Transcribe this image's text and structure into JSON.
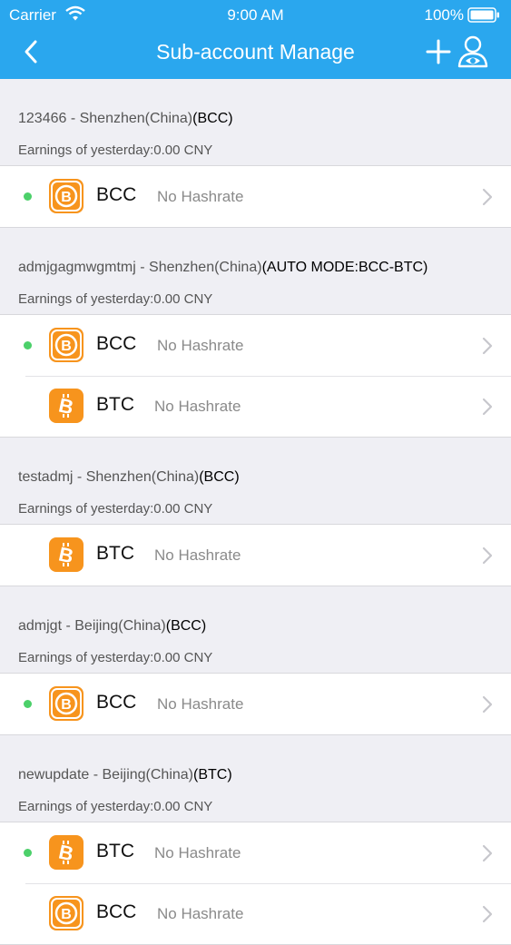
{
  "status_bar": {
    "carrier": "Carrier",
    "time": "9:00 AM",
    "battery": "100%"
  },
  "nav": {
    "title": "Sub-account Manage"
  },
  "groups": [
    {
      "name": "123466 - Shenzhen(China)",
      "mode": "(BCC)",
      "earnings": "Earnings of yesterday:0.00 CNY",
      "rows": [
        {
          "coin": "BCC",
          "hashrate": "No Hashrate",
          "active": true
        }
      ]
    },
    {
      "name": "admjgagmwgmtmj - Shenzhen(China)",
      "mode": "(AUTO MODE:BCC-BTC)",
      "earnings": "Earnings of yesterday:0.00 CNY",
      "rows": [
        {
          "coin": "BCC",
          "hashrate": "No Hashrate",
          "active": true
        },
        {
          "coin": "BTC",
          "hashrate": "No Hashrate",
          "active": false
        }
      ]
    },
    {
      "name": "testadmj - Shenzhen(China)",
      "mode": "(BCC)",
      "earnings": "Earnings of yesterday:0.00 CNY",
      "rows": [
        {
          "coin": "BTC",
          "hashrate": "No Hashrate",
          "active": false
        }
      ]
    },
    {
      "name": "admjgt - Beijing(China)",
      "mode": "(BCC)",
      "earnings": "Earnings of yesterday:0.00 CNY",
      "rows": [
        {
          "coin": "BCC",
          "hashrate": "No Hashrate",
          "active": true
        }
      ]
    },
    {
      "name": "newupdate - Beijing(China)",
      "mode": "(BTC)",
      "earnings": "Earnings of yesterday:0.00 CNY",
      "rows": [
        {
          "coin": "BTC",
          "hashrate": "No Hashrate",
          "active": true
        },
        {
          "coin": "BCC",
          "hashrate": "No Hashrate",
          "active": false
        }
      ]
    }
  ],
  "colors": {
    "nav": "#2aa7ee",
    "active_dot": "#4cd06a",
    "coin_orange": "#f7941d"
  },
  "icons": [
    "back-arrow-icon",
    "add-icon",
    "user-eye-icon",
    "bitcoin-cash-icon",
    "bitcoin-icon",
    "chevron-right-icon",
    "wifi-icon",
    "battery-icon"
  ]
}
